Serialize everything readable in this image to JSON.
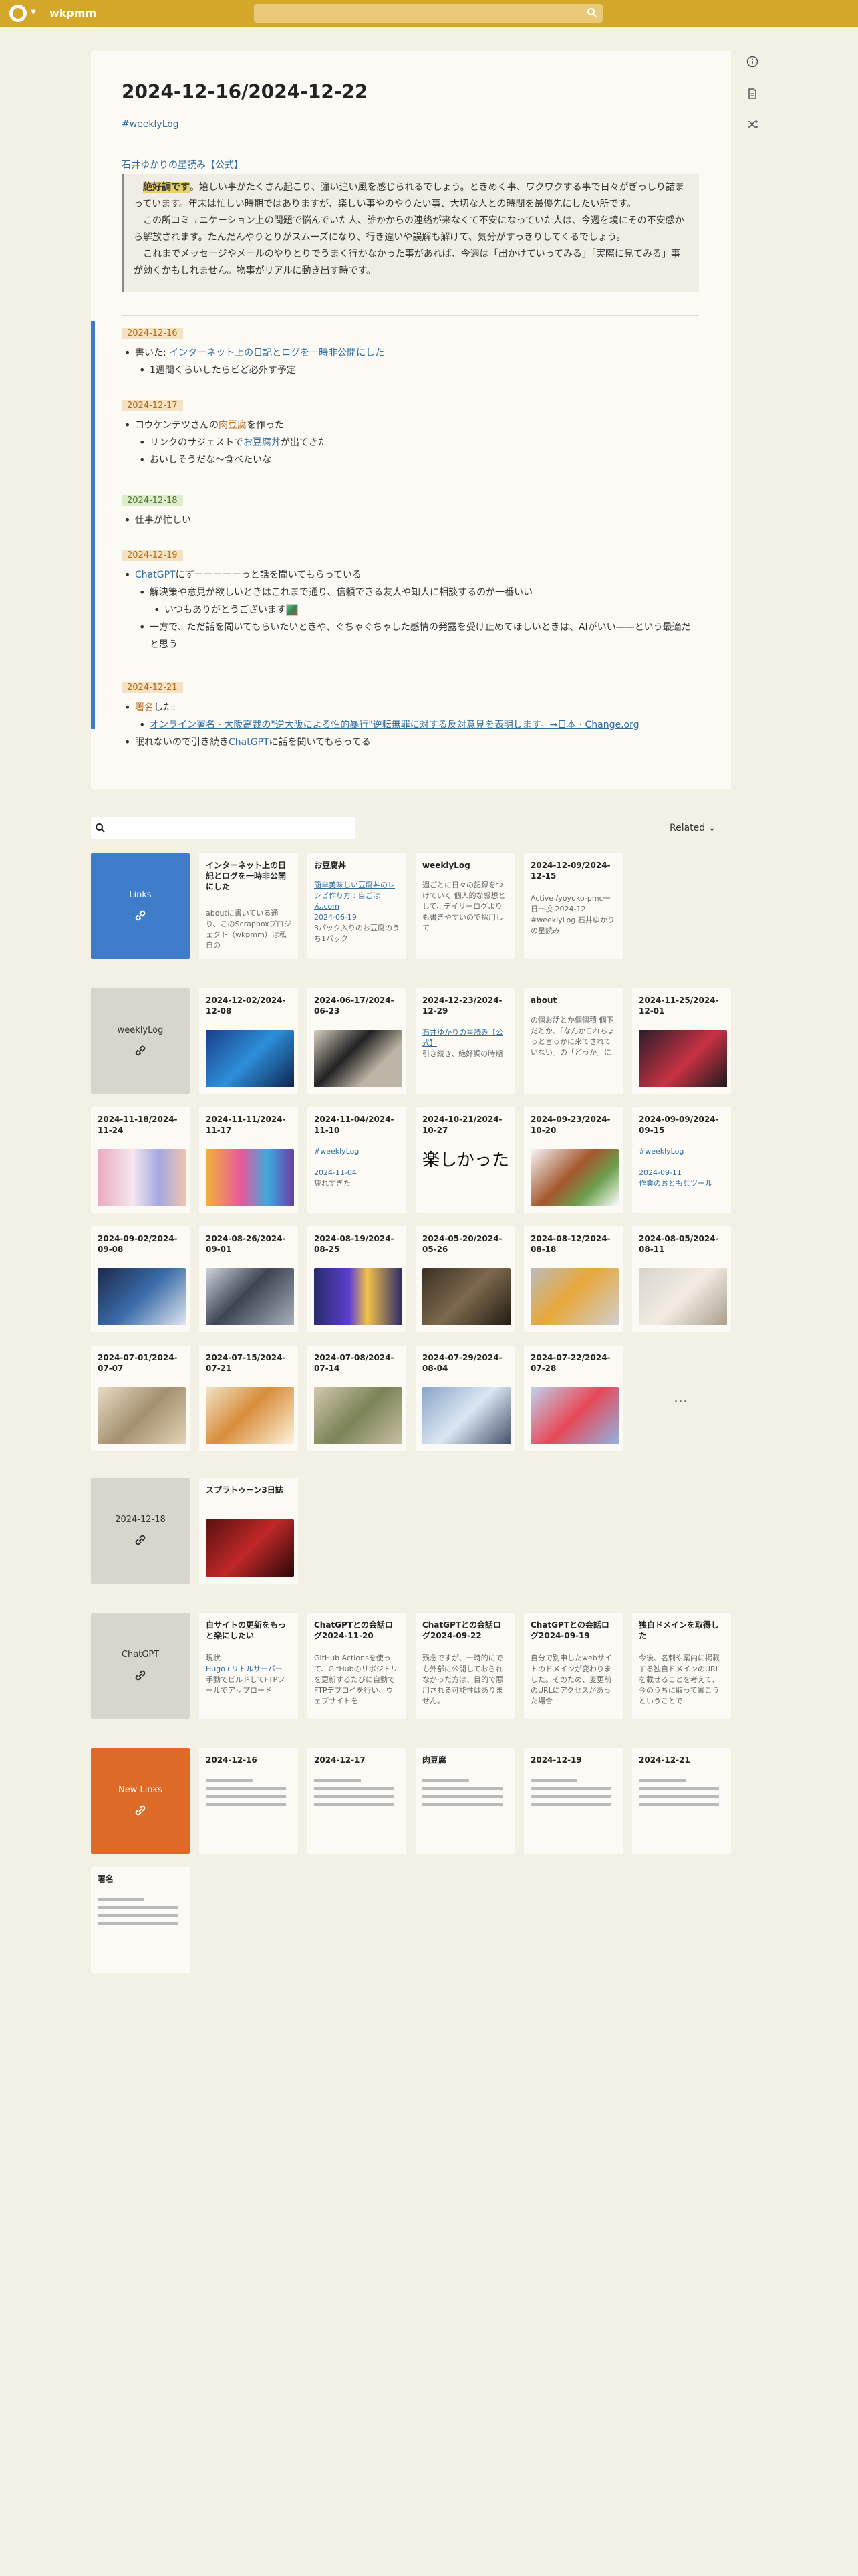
{
  "app": {
    "title": "wkpmm"
  },
  "page": {
    "title": "2024-12-16/2024-12-22",
    "hashtag": "#weeklyLog",
    "horoscope_link": "石井ゆかりの星読み【公式】",
    "quote": {
      "highlight": "絶好調です",
      "line1": "。嬉しい事がたくさん起こり、強い追い風を感じられるでしょう。ときめく事、ワクワクする事で日々がぎっしり詰まっています。年末は忙しい時期ではありますが、楽しい事やのやりたい事、大切な人との時間を最優先にしたい所です。",
      "line2": "この所コミュニケーション上の問題で悩んでいた人、誰かからの連絡が来なくて不安になっていた人は、今週を境にその不安感から解放されます。たんだんやりとりがスムーズになり、行き違いや誤解も解けて、気分がすっきりしてくるでしょう。",
      "line3": "これまでメッセージやメールのやりとりでうまく行かなかった事があれば、今週は「出かけていってみる」「実際に見てみる」事が効くかもしれません。物事がリアルに動き出す時です。"
    },
    "days": [
      {
        "date": "2024-12-16",
        "items": [
          {
            "prefix": "書いた: ",
            "link": "インターネット上の日記とログを一時非公開にした"
          },
          {
            "text": "1週間くらいしたらビど必外す予定"
          }
        ]
      },
      {
        "date": "2024-12-17",
        "items": [
          {
            "text_a": "コウケンテツさんの",
            "link": "肉豆腐",
            "text_b": "を作った"
          },
          {
            "text_a": "リンクのサジェストで",
            "link": "お豆腐丼",
            "text_b": "が出てきた"
          },
          {
            "text": "おいしそうだな〜食べたいな"
          }
        ]
      },
      {
        "date": "2024-12-18",
        "items": [
          {
            "text": "仕事が忙しい"
          }
        ]
      },
      {
        "date": "2024-12-19",
        "items": [
          {
            "link": "ChatGPT",
            "text_b": "にずーーーーーっと話を聞いてもらっている"
          },
          {
            "text": "解決策や意見が欲しいときはこれまで通り、信頼できる友人や知人に相談するのが一番いい"
          },
          {
            "text": "いつもありがとうございます"
          },
          {
            "text": "一方で、ただ話を聞いてもらいたいときや、ぐちゃぐちゃした感情の発露を受け止めてほしいときは、AIがいい——という最適だと思う"
          }
        ]
      },
      {
        "date": "2024-12-21",
        "items": [
          {
            "link": "署名",
            "text_b": "した:"
          },
          {
            "link": "オンライン署名 · 大阪高裁の\"逆大阪による性的暴行\"逆転無罪に対する反対意見を表明します。→日本 · Change.org"
          },
          {
            "text_a": "眠れないので引き続き",
            "link": "ChatGPT",
            "text_b": "に話を聞いてもらってる"
          }
        ]
      }
    ]
  },
  "related": {
    "label": "Related"
  },
  "groups": {
    "links": {
      "hub": "Links",
      "cards": [
        {
          "title": "インターネット上の日記とログを一時非公開にした",
          "body": "aboutに書いている通り、このScrapboxプロジェクト（wkpmm）は私自の"
        },
        {
          "title": "お豆腐丼",
          "link": "簡単美味しい豆腐丼のレシピ作り方 : 自ごはん.com",
          "body_link": "2024-06-19",
          "body": "3パック入りのお豆腐のうち1パック"
        },
        {
          "title": "weeklyLog",
          "body": "週ごとに日々の記録をつけていく 個人的な感想として、デイリーログよりも書きやすいので採用して"
        },
        {
          "title": "2024-12-09/2024-12-15",
          "body": "Active /yoyuko-pmc一日一投 2024-12 #weeklyLog 石井ゆかりの星読み"
        }
      ]
    },
    "weeklylog": {
      "hub": "weeklyLog",
      "cards": [
        {
          "title": "2024-12-02/2024-12-08"
        },
        {
          "title": "2024-06-17/2024-06-23"
        },
        {
          "title": "2024-12-23/2024-12-29",
          "link": "石井ゆかりの星読み【公式】",
          "body": "引き続き、絶好調の時期"
        },
        {
          "title": "about",
          "body": "の個お話とか個個積 個下だとか、「なんかこれちょっと言っかに来てされていない」の「どっか」に"
        },
        {
          "title": "2024-11-25/2024-12-01"
        },
        {
          "title": "2024-11-18/2024-11-24"
        },
        {
          "title": "2024-11-11/2024-11-17"
        },
        {
          "title": "2024-11-04/2024-11-10",
          "body_link": "#weeklyLog",
          "body2_link": "2024-11-04",
          "body": "疲れすぎた"
        },
        {
          "title": "2024-10-21/2024-10-27",
          "big": "楽しかった"
        },
        {
          "title": "2024-09-23/2024-10-20"
        },
        {
          "title": "2024-09-09/2024-09-15",
          "body_link": "#weeklyLog",
          "body2_link": "2024-09-11",
          "body": "作業のおとも兵ツール"
        },
        {
          "title": "2024-09-02/2024-09-08"
        },
        {
          "title": "2024-08-26/2024-09-01"
        },
        {
          "title": "2024-08-19/2024-08-25"
        },
        {
          "title": "2024-05-20/2024-05-26"
        },
        {
          "title": "2024-08-12/2024-08-18"
        },
        {
          "title": "2024-08-05/2024-08-11"
        },
        {
          "title": "2024-07-01/2024-07-07"
        },
        {
          "title": "2024-07-15/2024-07-21"
        },
        {
          "title": "2024-07-08/2024-07-14"
        },
        {
          "title": "2024-07-29/2024-08-04"
        },
        {
          "title": "2024-07-22/2024-07-28"
        }
      ],
      "more": "..."
    },
    "d1218": {
      "hub": "2024-12-18",
      "cards": [
        {
          "title": "スプラトゥーン3日誌"
        }
      ]
    },
    "chatgpt": {
      "hub": "ChatGPT",
      "cards": [
        {
          "title": "自サイトの更新をもっと楽にしたい",
          "body": "現状",
          "body_link": "Hugo+リトルサーバー",
          "body2": "手動でビルドしてFTPツールでアップロード"
        },
        {
          "title": "ChatGPTとの会話ログ2024-11-20",
          "body": "GitHub Actionsを使って、GitHubのリポジトリを更新するたびに自動でFTPデプロイを行い、ウェブサイトを"
        },
        {
          "title": "ChatGPTとの会話ログ2024-09-22",
          "body": "残念ですが、一時的にでも外部に公開しておられなかった方は、目的で悪用される可能性はありません。"
        },
        {
          "title": "ChatGPTとの会話ログ2024-09-19",
          "body": "自分で別申したwebサイトのドメインが変わりました。そのため、変更前のURLにアクセスがあった場合"
        },
        {
          "title": "独自ドメインを取得した",
          "body": "今後、名刺や案内に掲載する独自ドメインのURLを載せることを考えて、今のうちに取って置こうということで"
        }
      ]
    },
    "newlinks": {
      "hub": "New Links",
      "cards": [
        {
          "title": "2024-12-16"
        },
        {
          "title": "2024-12-17"
        },
        {
          "title": "肉豆腐"
        },
        {
          "title": "2024-12-19"
        },
        {
          "title": "2024-12-21"
        },
        {
          "title": "署名"
        }
      ]
    }
  },
  "colors": {
    "navbar": "#d4a62a",
    "link": "#2f6da0",
    "accent_blue": "#3e7bc9",
    "accent_orange": "#dd6b27"
  }
}
